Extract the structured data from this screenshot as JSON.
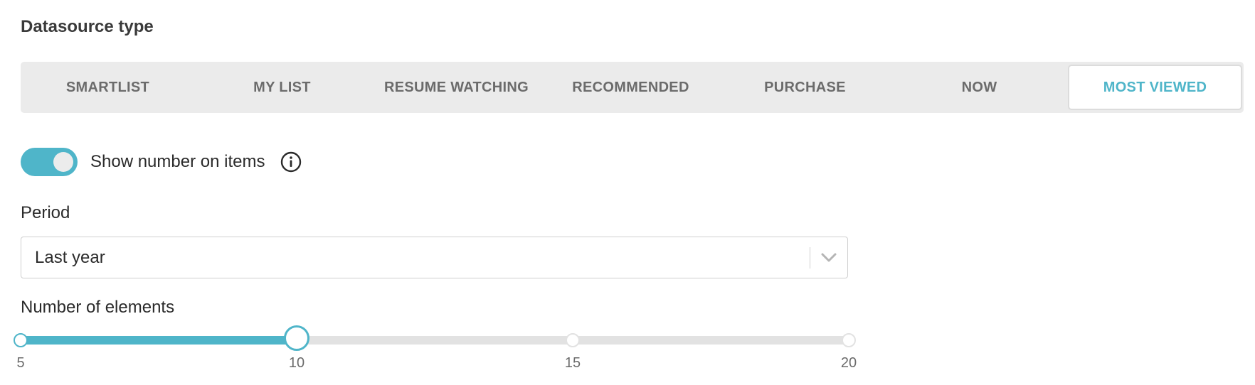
{
  "datasource": {
    "title": "Datasource type",
    "options": [
      "SMARTLIST",
      "MY LIST",
      "RESUME WATCHING",
      "RECOMMENDED",
      "PURCHASE",
      "NOW",
      "MOST VIEWED"
    ],
    "selected": "MOST VIEWED"
  },
  "show_number": {
    "label": "Show number on items",
    "enabled": true,
    "info_icon": "info-icon"
  },
  "period": {
    "label": "Period",
    "value": "Last year",
    "chevron_icon": "chevron-down-icon"
  },
  "elements": {
    "label": "Number of elements",
    "min": 5,
    "max": 20,
    "value": 10,
    "ticks": [
      "5",
      "10",
      "15",
      "20"
    ]
  },
  "colors": {
    "accent": "#4fb5c9",
    "track": "#e2e2e2",
    "segment_bg": "#ebebeb"
  }
}
